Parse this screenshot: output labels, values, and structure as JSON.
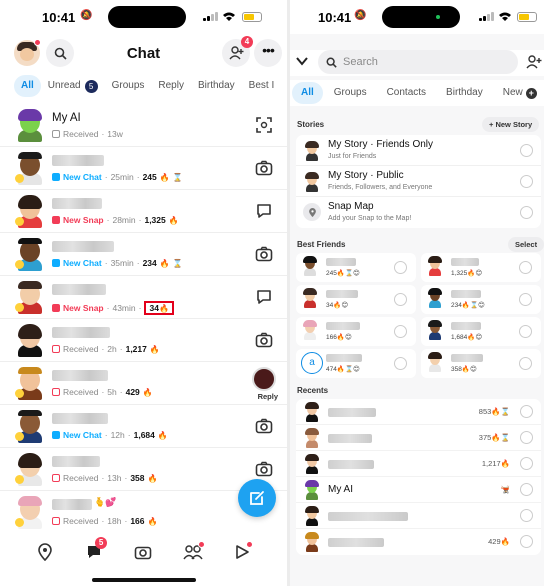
{
  "left": {
    "status": {
      "time": "10:41"
    },
    "header": {
      "title": "Chat",
      "add_friend_badge": "4"
    },
    "tabs": [
      {
        "label": "All",
        "active": true
      },
      {
        "label": "Unread",
        "count": "5"
      },
      {
        "label": "Groups"
      },
      {
        "label": "Reply"
      },
      {
        "label": "Birthday"
      },
      {
        "label": "Best I"
      }
    ],
    "rows": [
      {
        "name": "My AI",
        "status": "Received",
        "time": "13w",
        "streak": "",
        "action": "scan-icon"
      },
      {
        "status": "New Chat",
        "time": "25min",
        "streak": "245",
        "timer": "⌛",
        "action": "camera-icon"
      },
      {
        "status": "New Snap",
        "time": "28min",
        "streak": "1,325",
        "action": "chat-bubble-icon"
      },
      {
        "status": "New Chat",
        "time": "35min",
        "streak": "234",
        "timer": "⌛",
        "action": "camera-icon"
      },
      {
        "status": "New Snap",
        "time": "43min",
        "streak": "34",
        "action": "chat-bubble-icon"
      },
      {
        "status": "Received",
        "time": "2h",
        "streak": "1,217",
        "action": "camera-icon"
      },
      {
        "status": "Received",
        "time": "5h",
        "streak": "429",
        "action": "reply",
        "reply_label": "Reply"
      },
      {
        "status": "New Chat",
        "time": "12h",
        "streak": "1,684",
        "action": "camera-icon"
      },
      {
        "status": "Received",
        "time": "13h",
        "streak": "358",
        "action": "camera-icon"
      },
      {
        "status": "Received",
        "time": "18h",
        "streak": "166",
        "action": ""
      }
    ],
    "nav": {
      "chat_badge": "5"
    }
  },
  "right": {
    "status": {
      "time": "10:41"
    },
    "search": {
      "placeholder": "Search"
    },
    "tabs": [
      {
        "label": "All",
        "active": true
      },
      {
        "label": "Groups"
      },
      {
        "label": "Contacts"
      },
      {
        "label": "Birthday"
      },
      {
        "label": "New"
      }
    ],
    "stories": {
      "title": "Stories",
      "new_story": "+ New Story",
      "items": [
        {
          "title": "My Story · Friends Only",
          "subtitle": "Just for Friends"
        },
        {
          "title": "My Story · Public",
          "subtitle": "Friends, Followers, and Everyone"
        },
        {
          "title": "Snap Map",
          "subtitle": "Add your Snap to the Map!"
        }
      ]
    },
    "best_friends": {
      "title": "Best Friends",
      "select": "Select",
      "items": [
        {
          "meta": "245🔥⌛😊"
        },
        {
          "meta": "1,325🔥😊"
        },
        {
          "meta": "34🔥😊"
        },
        {
          "meta": "234🔥⌛😊"
        },
        {
          "meta": "166🔥😊"
        },
        {
          "meta": "1,684🔥😊"
        },
        {
          "meta": "474🔥⌛😊",
          "letter": "a"
        },
        {
          "meta": "358🔥😊"
        }
      ]
    },
    "recents": {
      "title": "Recents",
      "items": [
        {
          "meta": "853🔥⌛"
        },
        {
          "meta": "375🔥⌛"
        },
        {
          "meta": "1,217🔥"
        },
        {
          "name": "My AI",
          "meta": "🫕"
        },
        {
          "meta": ""
        },
        {
          "meta": "429🔥"
        }
      ]
    }
  }
}
